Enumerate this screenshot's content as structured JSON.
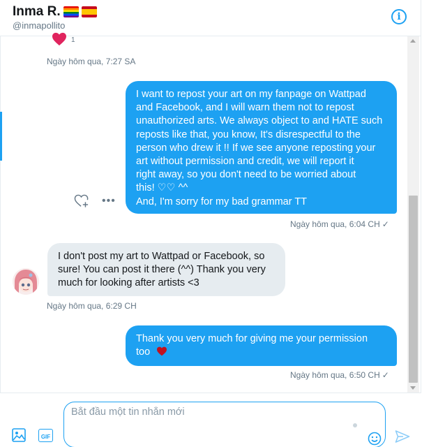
{
  "header": {
    "name": "Inma R.",
    "handle": "@inmapollito",
    "flags": [
      "rainbow-flag",
      "spain-flag"
    ],
    "info_icon": "info-icon",
    "info_glyph": "i"
  },
  "conversation": {
    "reaction": {
      "icon": "heart-icon",
      "count": "1",
      "color": "#e0245e"
    },
    "timestamps": {
      "first": "Ngày hôm qua, 7:27 SA",
      "out1": "Ngày hôm qua, 6:04 CH",
      "in1": "Ngày hôm qua, 6:29 CH",
      "out2": "Ngày hôm qua, 6:50 CH"
    },
    "check_glyph": "✓",
    "messages": {
      "out1": [
        "I want to repost your art on my fanpage on Wattpad",
        "and Facebook, and I will warn them not to repost",
        "unauthorized arts. We always object to and HATE such",
        "reposts like that, you know, It's disrespectful to the",
        "person who drew it !! If we see anyone reposting your",
        "art without permission and credit, we will report it",
        "right away, so you don't need to be worried about",
        "this! ♡♡ ^^",
        "And, I'm sorry for my bad grammar TT"
      ],
      "in1": [
        "I don't post my art to Wattpad or Facebook, so",
        "sure! You can post it there (^^) Thank you very",
        "much for looking after artists <3"
      ],
      "out2": [
        "Thank you very much for giving me your permission",
        "too"
      ]
    },
    "tools": {
      "like_icon": "heart-add-icon",
      "more_icon": "more-icon",
      "more_glyph": "•••"
    }
  },
  "composer": {
    "placeholder": "Bắt đầu một tin nhắn mới",
    "media_icon": "image-icon",
    "gif_icon": "gif-icon",
    "gif_label": "GIF",
    "emoji_icon": "emoji-icon",
    "send_icon": "send-icon"
  },
  "colors": {
    "accent": "#1da1f2",
    "incoming_bubble": "#e6ecf0",
    "muted_text": "#657786",
    "heart": "#e0245e",
    "dark_heart": "#c1121f"
  }
}
